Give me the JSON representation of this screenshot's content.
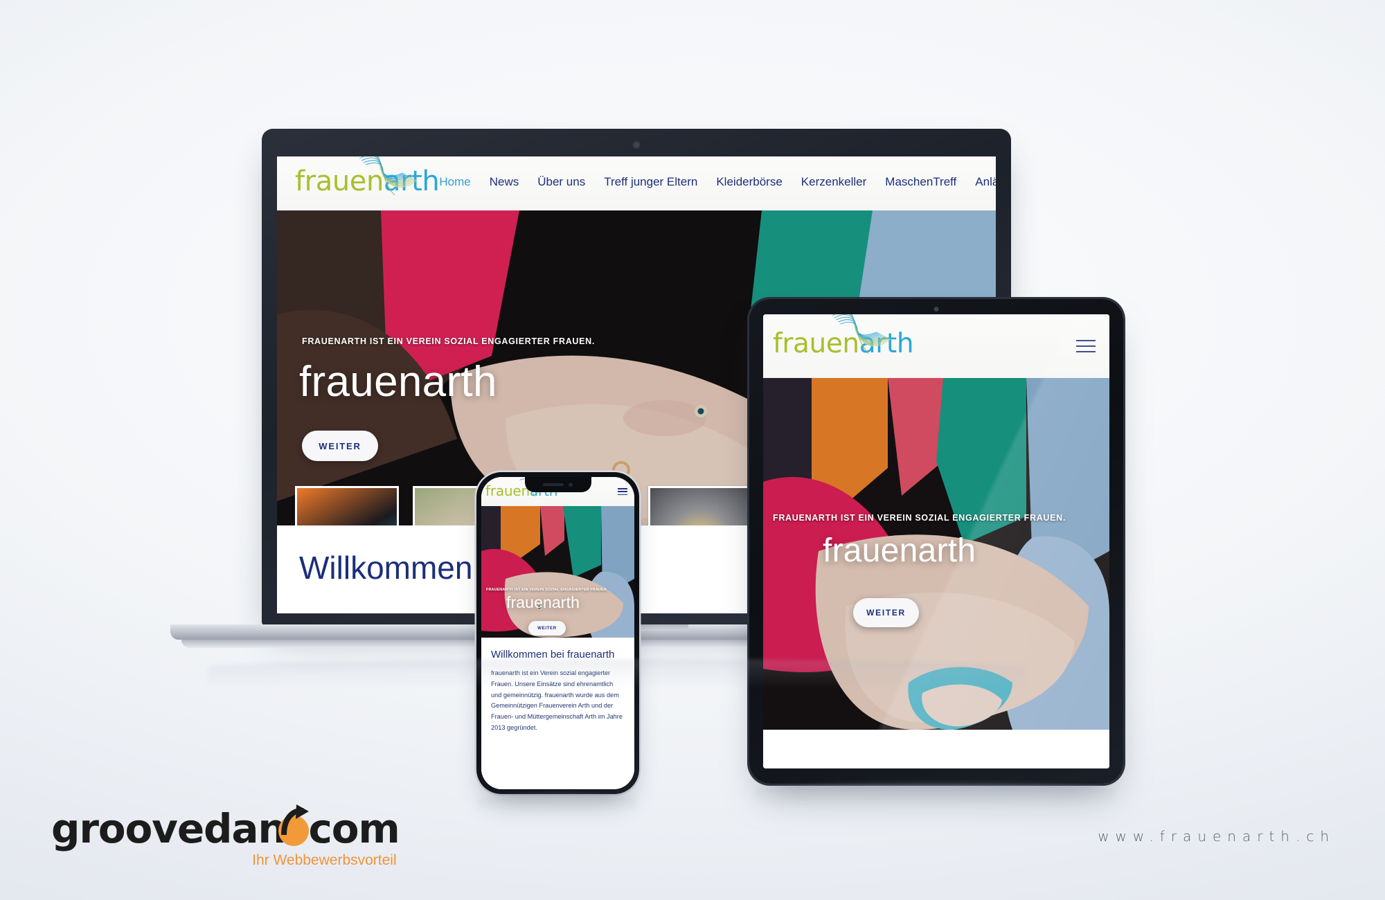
{
  "site": {
    "logo": {
      "part1": "frauen",
      "part2": "arth",
      "colors": {
        "part1": "#a9bf2c",
        "part2": "#2ba7d8"
      }
    },
    "nav_links": [
      {
        "label": "Home",
        "active": true
      },
      {
        "label": "News",
        "active": false
      },
      {
        "label": "Über uns",
        "active": false
      },
      {
        "label": "Treff junger Eltern",
        "active": false
      },
      {
        "label": "Kleiderbörse",
        "active": false
      },
      {
        "label": "Kerzenkeller",
        "active": false
      },
      {
        "label": "MaschenTreff",
        "active": false
      },
      {
        "label": "Anlässe",
        "active": false
      }
    ],
    "hero": {
      "tagline": "FRAUENARTH IST EIN VEREIN SOZIAL ENGAGIERTER FRAUEN.",
      "headline": "frauenarth",
      "cta_label": "WEITER"
    },
    "welcome": {
      "heading_full": "Willkommen bei frauenarth",
      "heading_clipped": "Willkommen bei",
      "body": "frauenarth ist ein Verein sozial engagierter Frauen. Unsere Einsätze sind ehrenamtlich und gemeinnützig. frauenarth wurde aus dem Gemeinnützigen Frauenverein Arth und der Frauen- und Müttergemeinschaft Arth im Jahre 2013 gegründet."
    },
    "colors": {
      "nav_link": "#1b2f7a",
      "nav_active": "#2f9fd4",
      "heading": "#1b2f7a",
      "button_text": "#1b2f7a"
    }
  },
  "footer": {
    "brand": {
      "part1": "groovedan",
      "part2": "com",
      "tagline": "Ihr Webbewerbsvorteil",
      "accent": "#f0933a"
    },
    "url": "www.frauenarth.ch"
  }
}
